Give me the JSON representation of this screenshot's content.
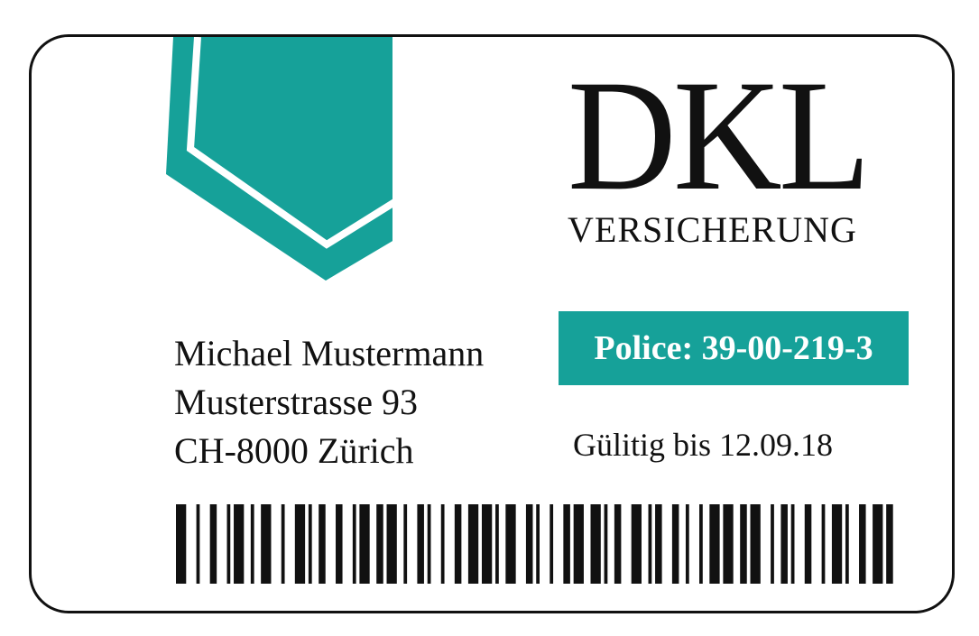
{
  "colors": {
    "accent": "#16a199",
    "ink": "#111111",
    "card": "#ffffff"
  },
  "brand": {
    "name": "DKL",
    "subtitle": "VERSICHERUNG"
  },
  "holder": {
    "name": "Michael Mustermann",
    "street": "Musterstrasse 93",
    "city": "CH-8000 Zürich"
  },
  "policy": {
    "label": "Police:",
    "number": "39-00-219-3"
  },
  "validity": {
    "text": "Gülitig bis 12.09.18"
  },
  "barcode": {
    "pattern": "3,3,1,3,2,3,1,1,3,2,1,2,3,3,1,3,3,1,1,2,2,3,2,3,1,1,3,2,2,1,3,2,1,3,2,1,1,3,1,3,2,2,3,1,3,1,1,2,3,3,2,1,1,3,1,3,2,1,3,2,3,1,1,2,2,3,3,2,1,1,2,3,2,2,1,3,1,2,3,1,3,2,2,1,3,3,1,2,2,1,1,3,2,3,1,2,3,1,1,3,2,2,3,1,2,3"
  }
}
